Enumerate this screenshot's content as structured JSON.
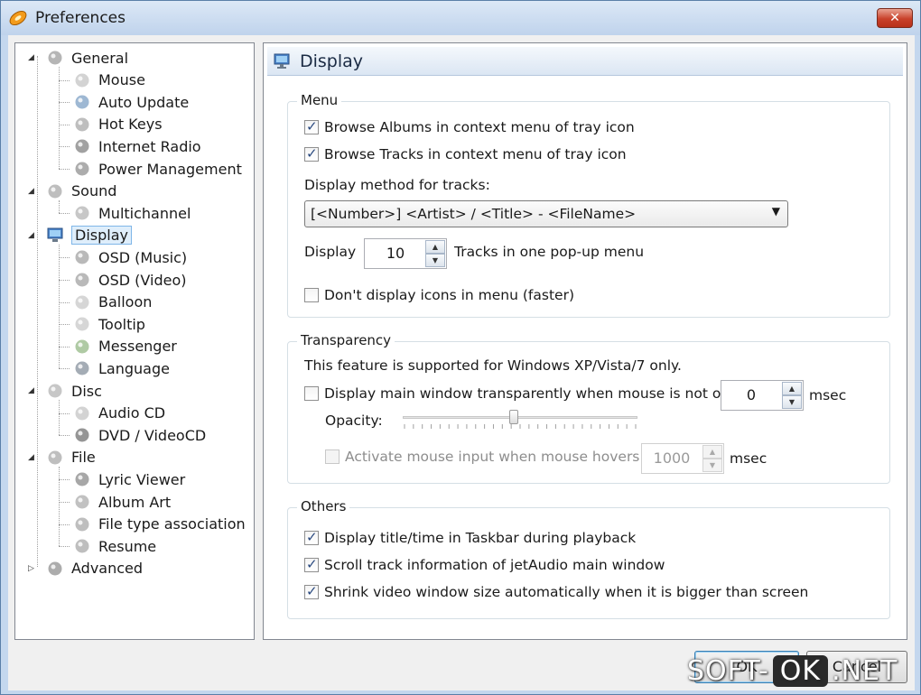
{
  "window": {
    "title": "Preferences",
    "close_label": "✕"
  },
  "tree": {
    "items": [
      {
        "label": "General",
        "icon": "checklist-icon",
        "level": 0,
        "expander": "◢"
      },
      {
        "label": "Mouse",
        "icon": "mouse-icon",
        "level": 1
      },
      {
        "label": "Auto Update",
        "icon": "globe-icon",
        "level": 1
      },
      {
        "label": "Hot Keys",
        "icon": "keyboard-icon",
        "level": 1
      },
      {
        "label": "Internet Radio",
        "icon": "radio-icon",
        "level": 1
      },
      {
        "label": "Power Management",
        "icon": "power-icon",
        "level": 1
      },
      {
        "label": "Sound",
        "icon": "speaker-icon",
        "level": 0,
        "expander": "◢"
      },
      {
        "label": "Multichannel",
        "icon": "multichannel-icon",
        "level": 1
      },
      {
        "label": "Display",
        "icon": "monitor-icon",
        "level": 0,
        "expander": "◢",
        "selected": true
      },
      {
        "label": "OSD (Music)",
        "icon": "osd-icon",
        "level": 1
      },
      {
        "label": "OSD (Video)",
        "icon": "osd-icon",
        "level": 1
      },
      {
        "label": "Balloon",
        "icon": "balloon-icon",
        "level": 1
      },
      {
        "label": "Tooltip",
        "icon": "tooltip-icon",
        "level": 1
      },
      {
        "label": "Messenger",
        "icon": "messenger-icon",
        "level": 1
      },
      {
        "label": "Language",
        "icon": "language-icon",
        "level": 1
      },
      {
        "label": "Disc",
        "icon": "disc-drive-icon",
        "level": 0,
        "expander": "◢"
      },
      {
        "label": "Audio CD",
        "icon": "cd-icon",
        "level": 1
      },
      {
        "label": "DVD / VideoCD",
        "icon": "dvd-icon",
        "level": 1
      },
      {
        "label": "File",
        "icon": "file-icon",
        "level": 0,
        "expander": "◢"
      },
      {
        "label": "Lyric Viewer",
        "icon": "microphone-icon",
        "level": 1
      },
      {
        "label": "Album Art",
        "icon": "album-art-icon",
        "level": 1
      },
      {
        "label": "File type association",
        "icon": "file-type-icon",
        "level": 1
      },
      {
        "label": "Resume",
        "icon": "resume-icon",
        "level": 1
      },
      {
        "label": "Advanced",
        "icon": "advanced-icon",
        "level": 0,
        "expander": "▷"
      }
    ]
  },
  "panel": {
    "title": "Display",
    "menu": {
      "legend": "Menu",
      "browse_albums": {
        "label": "Browse Albums in context menu of tray icon",
        "checked": true
      },
      "browse_tracks": {
        "label": "Browse Tracks in context menu of tray icon",
        "checked": true
      },
      "method_label": "Display method for tracks:",
      "method_value": "[<Number>] <Artist> / <Title> - <FileName>",
      "display_label": "Display",
      "display_count": "10",
      "tracks_label": "Tracks in one pop-up menu",
      "no_icons": {
        "label": "Don't display icons in menu (faster)",
        "checked": false
      }
    },
    "transparency": {
      "legend": "Transparency",
      "note": "This feature is supported for Windows XP/Vista/7 only.",
      "transparent": {
        "label": "Display main window transparently when mouse is not on it",
        "checked": false
      },
      "transparent_value": "0",
      "msec1": "msec",
      "opacity_label": "Opacity:",
      "opacity_level": 0.47,
      "mouse_input": {
        "label": "Activate mouse input when mouse hovers",
        "checked": false
      },
      "mouse_input_value": "1000",
      "msec2": "msec"
    },
    "others": {
      "legend": "Others",
      "taskbar": {
        "label": "Display title/time in Taskbar during playback",
        "checked": true
      },
      "scroll": {
        "label": "Scroll track information of jetAudio main window",
        "checked": true
      },
      "shrink": {
        "label": "Shrink video window size automatically when it is bigger than screen",
        "checked": true
      }
    }
  },
  "buttons": {
    "ok": "OK",
    "cancel": "Cancel"
  },
  "watermark": {
    "part1": "SOFT-",
    "part2": "OK",
    "part3": ".NET"
  },
  "colors": {
    "selection": "#dfeefb",
    "accent": "#3c7fb1",
    "close": "#c8412a"
  }
}
